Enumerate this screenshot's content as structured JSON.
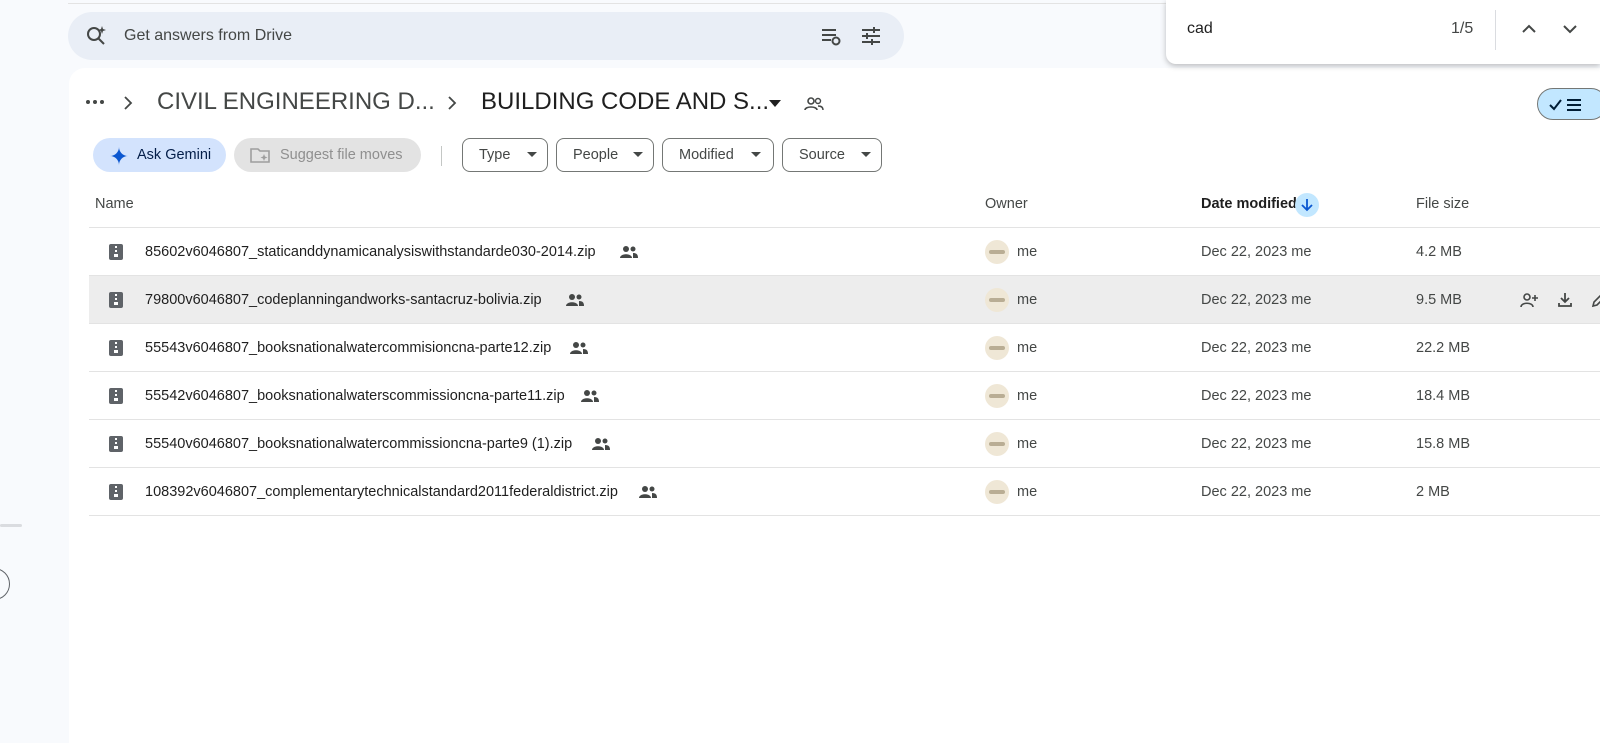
{
  "search": {
    "placeholder": "Get answers from Drive"
  },
  "breadcrumb": {
    "parent": "CIVIL ENGINEERING D...",
    "current": "BUILDING CODE AND S..."
  },
  "actions": {
    "ask_gemini": "Ask Gemini",
    "suggest_moves": "Suggest file moves"
  },
  "filters": [
    "Type",
    "People",
    "Modified",
    "Source"
  ],
  "columns": {
    "name": "Name",
    "owner": "Owner",
    "date_modified": "Date modified",
    "file_size": "File size"
  },
  "files": [
    {
      "name": "85602v6046807_staticanddynamicanalysiswithstandarde030-2014.zip",
      "owner": "me",
      "date": "Dec 22, 2023 me",
      "size": "4.2 MB"
    },
    {
      "name": "79800v6046807_codeplanningandworks-santacruz-bolivia.zip",
      "owner": "me",
      "date": "Dec 22, 2023 me",
      "size": "9.5 MB"
    },
    {
      "name": "55543v6046807_booksnationalwatercommisioncna-parte12.zip",
      "owner": "me",
      "date": "Dec 22, 2023 me",
      "size": "22.2 MB"
    },
    {
      "name": "55542v6046807_booksnationalwaterscommissioncna-parte11.zip",
      "owner": "me",
      "date": "Dec 22, 2023 me",
      "size": "18.4 MB"
    },
    {
      "name": "55540v6046807_booksnationalwatercommissioncna-parte9 (1).zip",
      "owner": "me",
      "date": "Dec 22, 2023 me",
      "size": "15.8 MB"
    },
    {
      "name": "108392v6046807_complementarytechnicalstandard2011federaldistrict.zip",
      "owner": "me",
      "date": "Dec 22, 2023 me",
      "size": "2 MB"
    }
  ],
  "find_bar": {
    "query": "cad",
    "count": "1/5"
  },
  "colors": {
    "accent": "#c2e7ff",
    "gemini_chip": "#d3e3fd",
    "search_bg": "#e9eef6",
    "hover_row": "#ededed"
  }
}
